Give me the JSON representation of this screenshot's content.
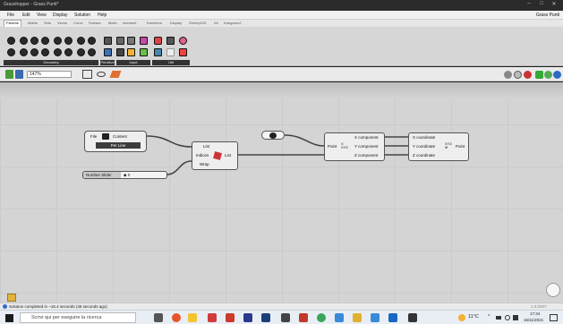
{
  "window": {
    "title": "Grasshopper - Grass Punti*",
    "controls": [
      "–",
      "□",
      "✕"
    ],
    "doc_name": "Grass Punti"
  },
  "menu": [
    "File",
    "Edit",
    "View",
    "Display",
    "Solution",
    "Help"
  ],
  "tabs": [
    "Params",
    "Maths",
    "Sets",
    "Vector",
    "Curve",
    "Surface",
    "Mesh",
    "Intersect",
    "Transform",
    "Display",
    "ShrimpGIS",
    "Kit",
    "Kangaroo2"
  ],
  "ribbon_panels": [
    "Geometry",
    "Primitive",
    "Input",
    "Util"
  ],
  "toolbar": {
    "zoom": "147%"
  },
  "components": {
    "file_path": {
      "label_left": "File",
      "label_right": "Content",
      "sub": "Per Line"
    },
    "list_item": {
      "inputs": [
        "List",
        "Indices",
        "Wrap"
      ],
      "output": "List"
    },
    "slider": {
      "label": "Number Slider",
      "value": "◆ 0"
    },
    "deconstruct": {
      "inputs_left": "Point",
      "symbol": "X\nXYZ",
      "outputs": [
        "X component",
        "Y component",
        "Z component"
      ]
    },
    "construct": {
      "inputs": [
        "X coordinate",
        "Y coordinate",
        "Z coordinate"
      ],
      "symbol": "XYZ\n⊕",
      "output": "Point"
    }
  },
  "status": {
    "text": "Solution completed in ~15.4 seconds (46 seconds ago)",
    "version": "1.0.0007"
  },
  "taskbar": {
    "search_placeholder": "Scrivi qui per eseguire la ricerca",
    "weather": "11°C",
    "time": "17:34",
    "date": "16/11/2021"
  }
}
